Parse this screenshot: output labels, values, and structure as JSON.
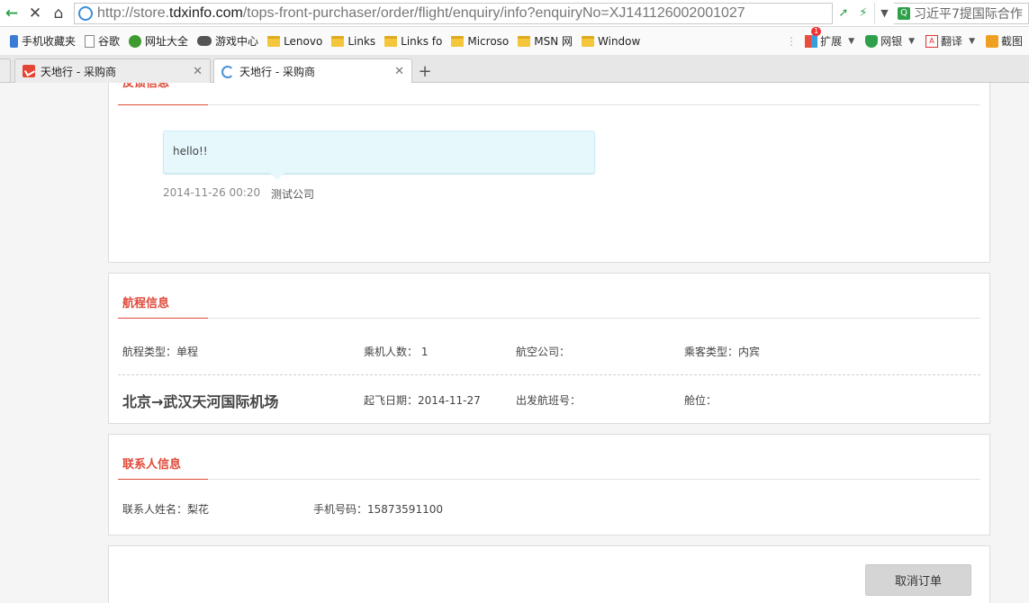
{
  "browser": {
    "url_prefix": "http://store.",
    "url_host": "tdxinfo.com",
    "url_path": "/tops-front-purchaser/order/flight/enquiry/info?enquiryNo=XJ141126002001027",
    "search_text": "习近平7提国际合作",
    "bookmarks": [
      {
        "label": "手机收藏夹",
        "icon": "phone-icon"
      },
      {
        "label": "谷歌",
        "icon": "page-icon"
      },
      {
        "label": "网址大全",
        "icon": "nav-icon"
      },
      {
        "label": "游戏中心",
        "icon": "game-icon"
      },
      {
        "label": "Lenovo",
        "icon": "folder-icon"
      },
      {
        "label": "Links",
        "icon": "folder-icon"
      },
      {
        "label": "Links fo",
        "icon": "folder-icon"
      },
      {
        "label": "Microso",
        "icon": "folder-icon"
      },
      {
        "label": "MSN 网",
        "icon": "folder-icon"
      },
      {
        "label": "Window",
        "icon": "folder-icon"
      }
    ],
    "extensions": {
      "expand_label": "扩展",
      "expand_badge": "1",
      "bank_label": "网银",
      "translate_label": "翻译",
      "screenshot_label": "截图"
    },
    "tabs": [
      {
        "title": "天地行 - 采购商"
      },
      {
        "title": "天地行 - 采购商"
      }
    ]
  },
  "feedback": {
    "title": "反馈信息",
    "message": "hello!!",
    "time": "2014-11-26 00:20",
    "company": "测试公司"
  },
  "itinerary": {
    "title": "航程信息",
    "trip_type": "航程类型：单程",
    "passenger_count": "乘机人数： 1",
    "airline": "航空公司：",
    "passenger_type": "乘客类型：内宾",
    "route": "北京→武汉天河国际机场",
    "departure_date": "起飞日期：2014-11-27",
    "flight_no": "出发航班号：",
    "cabin": "舱位："
  },
  "contact": {
    "title": "联系人信息",
    "name": "联系人姓名：梨花",
    "phone": "手机号码：15873591100"
  },
  "actions": {
    "cancel_label": "取消订单"
  }
}
